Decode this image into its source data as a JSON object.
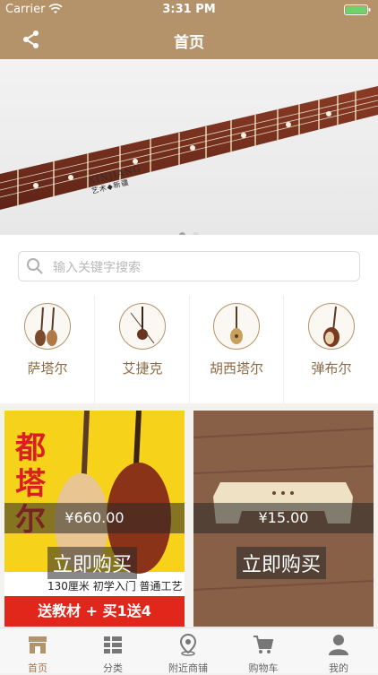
{
  "status_bar": {
    "carrier": "Carrier",
    "time": "3:31 PM"
  },
  "nav": {
    "title": "首页"
  },
  "search": {
    "placeholder": "输入关键字搜索"
  },
  "banner": {
    "brand_line1": "XINJIANG",
    "brand_line2": "艺术◆新疆",
    "pages": 2,
    "active_page": 1
  },
  "categories": [
    {
      "label": "萨塔尔"
    },
    {
      "label": "艾捷克"
    },
    {
      "label": "胡西塔尔"
    },
    {
      "label": "弹布尔"
    }
  ],
  "products": [
    {
      "price": "¥660.00",
      "buy_label": "立即购买",
      "ad_title": "都塔尔",
      "ad_line": "130厘米  初学入门  普通工艺",
      "ad_promo": "送教材 + 买1送4"
    },
    {
      "price": "¥15.00",
      "buy_label": "立即购买"
    }
  ],
  "tabs": [
    {
      "label": "首页",
      "icon": "shop-icon"
    },
    {
      "label": "分类",
      "icon": "category-icon"
    },
    {
      "label": "附近商铺",
      "icon": "location-icon"
    },
    {
      "label": "购物车",
      "icon": "cart-icon"
    },
    {
      "label": "我的",
      "icon": "user-icon"
    }
  ],
  "colors": {
    "brand": "#b4926a",
    "accent_text": "#8b6a45",
    "active_tab": "#a0764c"
  }
}
